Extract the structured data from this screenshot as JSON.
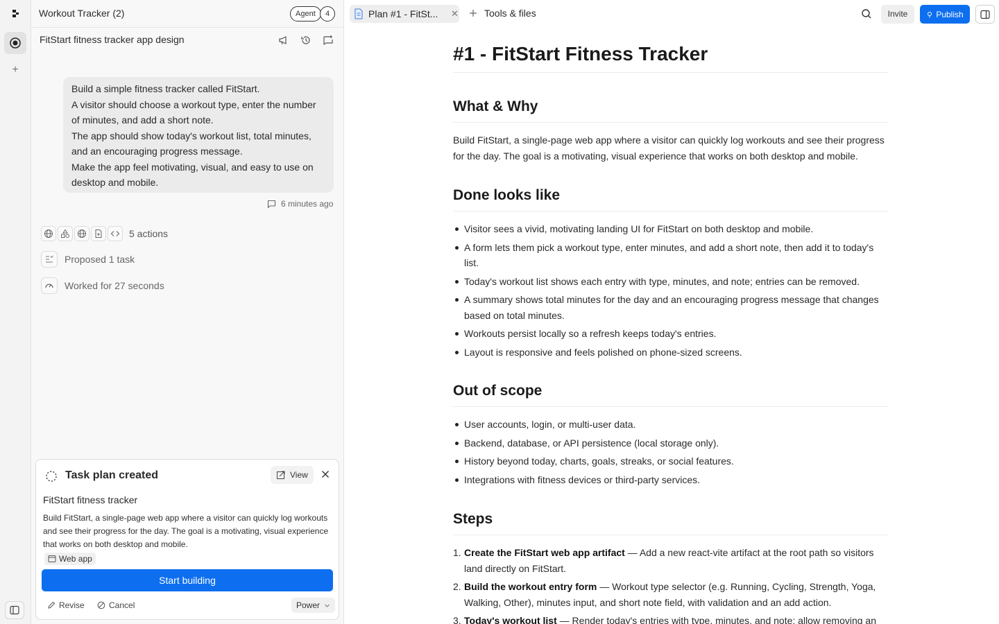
{
  "app": {
    "title": "Workout Tracker (2)",
    "agent_label": "Agent",
    "agent_count": "4"
  },
  "chat": {
    "subtitle": "FitStart fitness tracker app design",
    "message_lines": [
      "Build a simple fitness tracker called FitStart.",
      "A visitor should choose a workout type, enter the number",
      "of minutes, and add a short note.",
      "The app should show today's workout list, total minutes,",
      "and an encouraging progress message.",
      "Make the app feel motivating, visual, and easy to use on",
      "desktop and mobile."
    ],
    "message_time": "6 minutes ago",
    "actions_label": "5 actions",
    "proposed_label": "Proposed 1 task",
    "worked_label": "Worked for 27 seconds"
  },
  "task_card": {
    "title": "Task plan created",
    "view_label": "View",
    "name": "FitStart fitness tracker",
    "description": "Build FitStart, a single-page web app where a visitor can quickly log workouts and see their progress for the day. The goal is a motivating, visual experience that works on both desktop and mobile.",
    "tag": "Web app",
    "start_label": "Start building",
    "revise_label": "Revise",
    "cancel_label": "Cancel",
    "power_label": "Power"
  },
  "topbar": {
    "tab_label": "Plan #1 - FitSt...",
    "tools_label": "Tools & files",
    "invite_label": "Invite",
    "publish_label": "Publish"
  },
  "doc": {
    "title": "#1 - FitStart Fitness Tracker",
    "what_heading": "What & Why",
    "what_text": "Build FitStart, a single-page web app where a visitor can quickly log workouts and see their progress for the day. The goal is a motivating, visual experience that works on both desktop and mobile.",
    "done_heading": "Done looks like",
    "done_items": [
      "Visitor sees a vivid, motivating landing UI for FitStart on both desktop and mobile.",
      "A form lets them pick a workout type, enter minutes, and add a short note, then add it to today's list.",
      "Today's workout list shows each entry with type, minutes, and note; entries can be removed.",
      "A summary shows total minutes for the day and an encouraging progress message that changes based on total minutes.",
      "Workouts persist locally so a refresh keeps today's entries.",
      "Layout is responsive and feels polished on phone-sized screens."
    ],
    "scope_heading": "Out of scope",
    "scope_items": [
      "User accounts, login, or multi-user data.",
      "Backend, database, or API persistence (local storage only).",
      "History beyond today, charts, goals, streaks, or social features.",
      "Integrations with fitness devices or third-party services."
    ],
    "steps_heading": "Steps",
    "steps": [
      {
        "num": "1.",
        "title": "Create the FitStart web app artifact",
        "text": " — Add a new react-vite artifact at the root path so visitors land directly on FitStart."
      },
      {
        "num": "2.",
        "title": "Build the workout entry form",
        "text": " — Workout type selector (e.g. Running, Cycling, Strength, Yoga, Walking, Other), minutes input, and short note field, with validation and an add action."
      },
      {
        "num": "3.",
        "title": "Today's workout list",
        "text": " — Render today's entries with type, minutes, and note; allow removing an"
      }
    ]
  }
}
